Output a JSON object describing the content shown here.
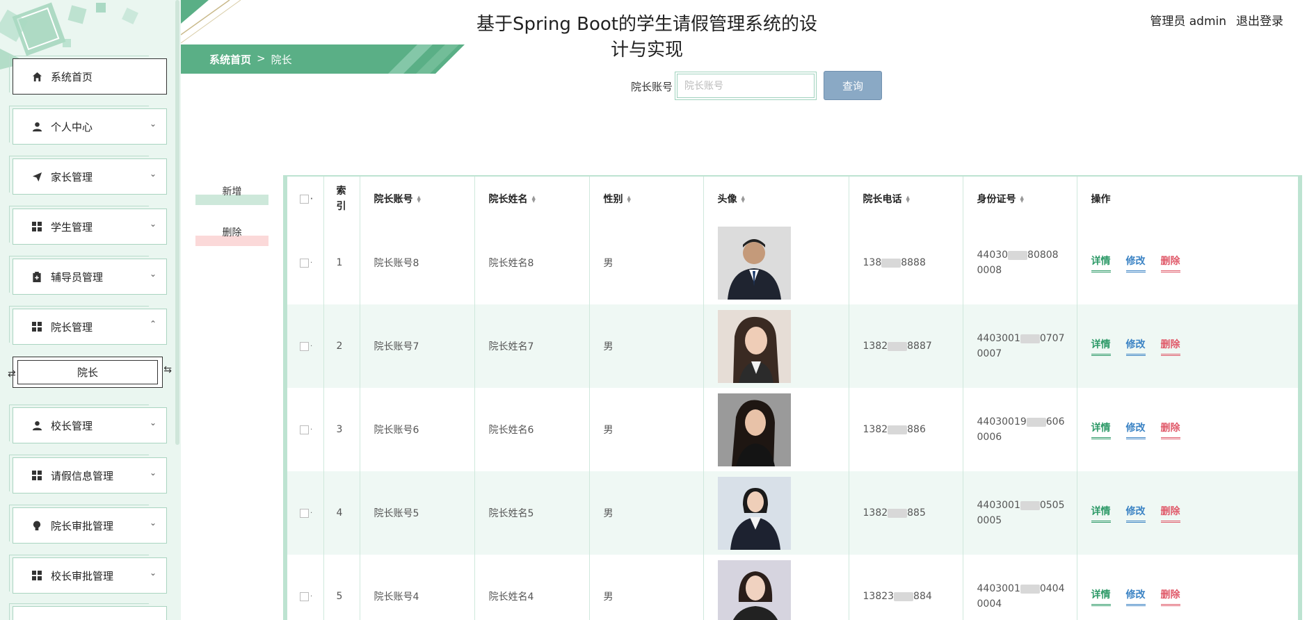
{
  "header": {
    "title": "基于Spring Boot的学生请假管理系统的设计与实现",
    "user_label": "管理员 admin",
    "logout_label": "退出登录"
  },
  "breadcrumb": {
    "home": "系统首页",
    "separator": ">",
    "current": "院长"
  },
  "sidebar": {
    "items": [
      {
        "label": "系统首页",
        "icon": "home-icon",
        "expandable": false
      },
      {
        "label": "个人中心",
        "icon": "user-icon",
        "expandable": true
      },
      {
        "label": "家长管理",
        "icon": "paper-plane-icon",
        "expandable": true
      },
      {
        "label": "学生管理",
        "icon": "grid-icon",
        "expandable": true
      },
      {
        "label": "辅导员管理",
        "icon": "clipboard-icon",
        "expandable": true
      },
      {
        "label": "院长管理",
        "icon": "grid-icon",
        "expandable": true,
        "expanded": true
      },
      {
        "label": "校长管理",
        "icon": "user-icon",
        "expandable": true
      },
      {
        "label": "请假信息管理",
        "icon": "grid-icon",
        "expandable": true
      },
      {
        "label": "院长审批管理",
        "icon": "bulb-icon",
        "expandable": true
      },
      {
        "label": "校长审批管理",
        "icon": "grid-icon",
        "expandable": true
      }
    ],
    "submenu": {
      "label": "院长"
    }
  },
  "search": {
    "label": "院长账号",
    "placeholder": "院长账号",
    "button": "查询"
  },
  "actions": {
    "add": "新增",
    "delete": "删除"
  },
  "table": {
    "columns": {
      "index": "索引",
      "account": "院长账号",
      "name": "院长姓名",
      "gender": "性别",
      "avatar": "头像",
      "phone": "院长电话",
      "id_card": "身份证号",
      "ops": "操作"
    },
    "ops": {
      "detail": "详情",
      "edit": "修改",
      "delete": "删除"
    },
    "rows": [
      {
        "index": "1",
        "account": "院长账号8",
        "name": "院长姓名8",
        "gender": "男",
        "phone_a": "138",
        "phone_b": "8888",
        "id_a": "44030",
        "id_b": "80808",
        "id_c": "0008"
      },
      {
        "index": "2",
        "account": "院长账号7",
        "name": "院长姓名7",
        "gender": "男",
        "phone_a": "1382",
        "phone_b": "8887",
        "id_a": "4403001",
        "id_b": "0707",
        "id_c": "0007"
      },
      {
        "index": "3",
        "account": "院长账号6",
        "name": "院长姓名6",
        "gender": "男",
        "phone_a": "1382",
        "phone_b": "886",
        "id_a": "44030019",
        "id_b": "606",
        "id_c": "0006"
      },
      {
        "index": "4",
        "account": "院长账号5",
        "name": "院长姓名5",
        "gender": "男",
        "phone_a": "1382",
        "phone_b": "885",
        "id_a": "4403001",
        "id_b": "0505",
        "id_c": "0005"
      },
      {
        "index": "5",
        "account": "院长账号4",
        "name": "院长姓名4",
        "gender": "男",
        "phone_a": "13823",
        "phone_b": "884",
        "id_a": "4403001",
        "id_b": "0404",
        "id_c": "0004"
      }
    ]
  },
  "colors": {
    "accent": "#5aaf86",
    "sidebar_bg": "#eaf6f0",
    "search_button": "#8aa9c5",
    "detail": "#2e9a68",
    "edit": "#3b83c4",
    "delete": "#e05a6a"
  }
}
